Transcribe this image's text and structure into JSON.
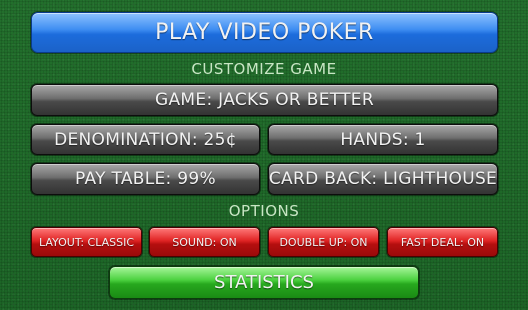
{
  "play_button": {
    "label": "PLAY VIDEO POKER"
  },
  "customize": {
    "heading": "CUSTOMIZE GAME",
    "game_label": "GAME: JACKS OR BETTER",
    "denomination_label": "DENOMINATION: 25¢",
    "hands_label": "HANDS: 1",
    "pay_table_label": "PAY TABLE: 99%",
    "card_back_label": "CARD BACK: LIGHTHOUSE"
  },
  "options": {
    "heading": "OPTIONS",
    "layout_label": "LAYOUT: CLASSIC",
    "sound_label": "SOUND: ON",
    "double_up_label": "DOUBLE UP: ON",
    "fast_deal_label": "FAST DEAL: ON"
  },
  "statistics_button": {
    "label": "STATISTICS"
  },
  "colors": {
    "felt": "#1f6a2a",
    "play_button": "#1c6cdc",
    "gray_button": "#4a4a4a",
    "option_button": "#b50f0f",
    "statistics_button": "#27a81e",
    "heading_text": "#c8e6c4"
  }
}
